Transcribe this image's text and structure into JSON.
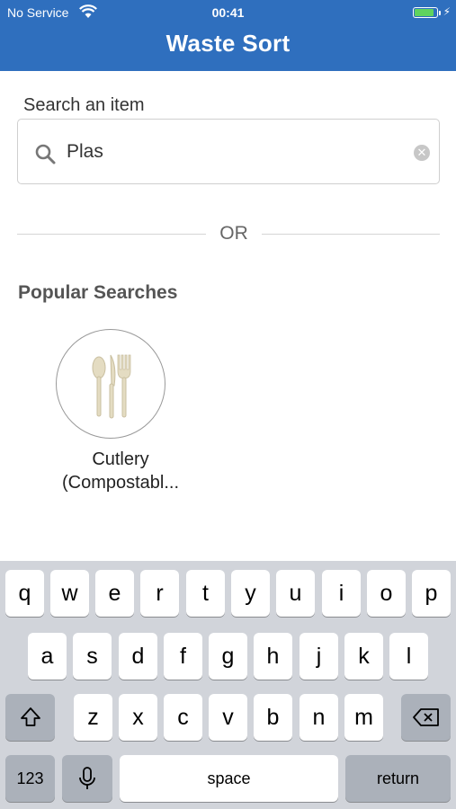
{
  "status_bar": {
    "carrier": "No Service",
    "time": "00:41",
    "battery_level": 0.9,
    "battery_color": "#5fd35f"
  },
  "header": {
    "title": "Waste Sort",
    "color": "#2f6fbe"
  },
  "search": {
    "label": "Search an item",
    "value": "Plas",
    "icon": "search-icon",
    "clear_icon": "clear-icon"
  },
  "divider": {
    "text": "OR"
  },
  "popular": {
    "title": "Popular Searches",
    "items": [
      {
        "line1": "Cutlery",
        "line2": "(Compostabl...",
        "icon": "cutlery-icon"
      }
    ]
  },
  "keyboard": {
    "row1": [
      "q",
      "w",
      "e",
      "r",
      "t",
      "y",
      "u",
      "i",
      "o",
      "p"
    ],
    "row2": [
      "a",
      "s",
      "d",
      "f",
      "g",
      "h",
      "j",
      "k",
      "l"
    ],
    "row3": [
      "z",
      "x",
      "c",
      "v",
      "b",
      "n",
      "m"
    ],
    "numbers_label": "123",
    "space_label": "space",
    "return_label": "return",
    "shift_icon": "shift-icon",
    "delete_icon": "delete-icon",
    "mic_icon": "microphone-icon"
  }
}
